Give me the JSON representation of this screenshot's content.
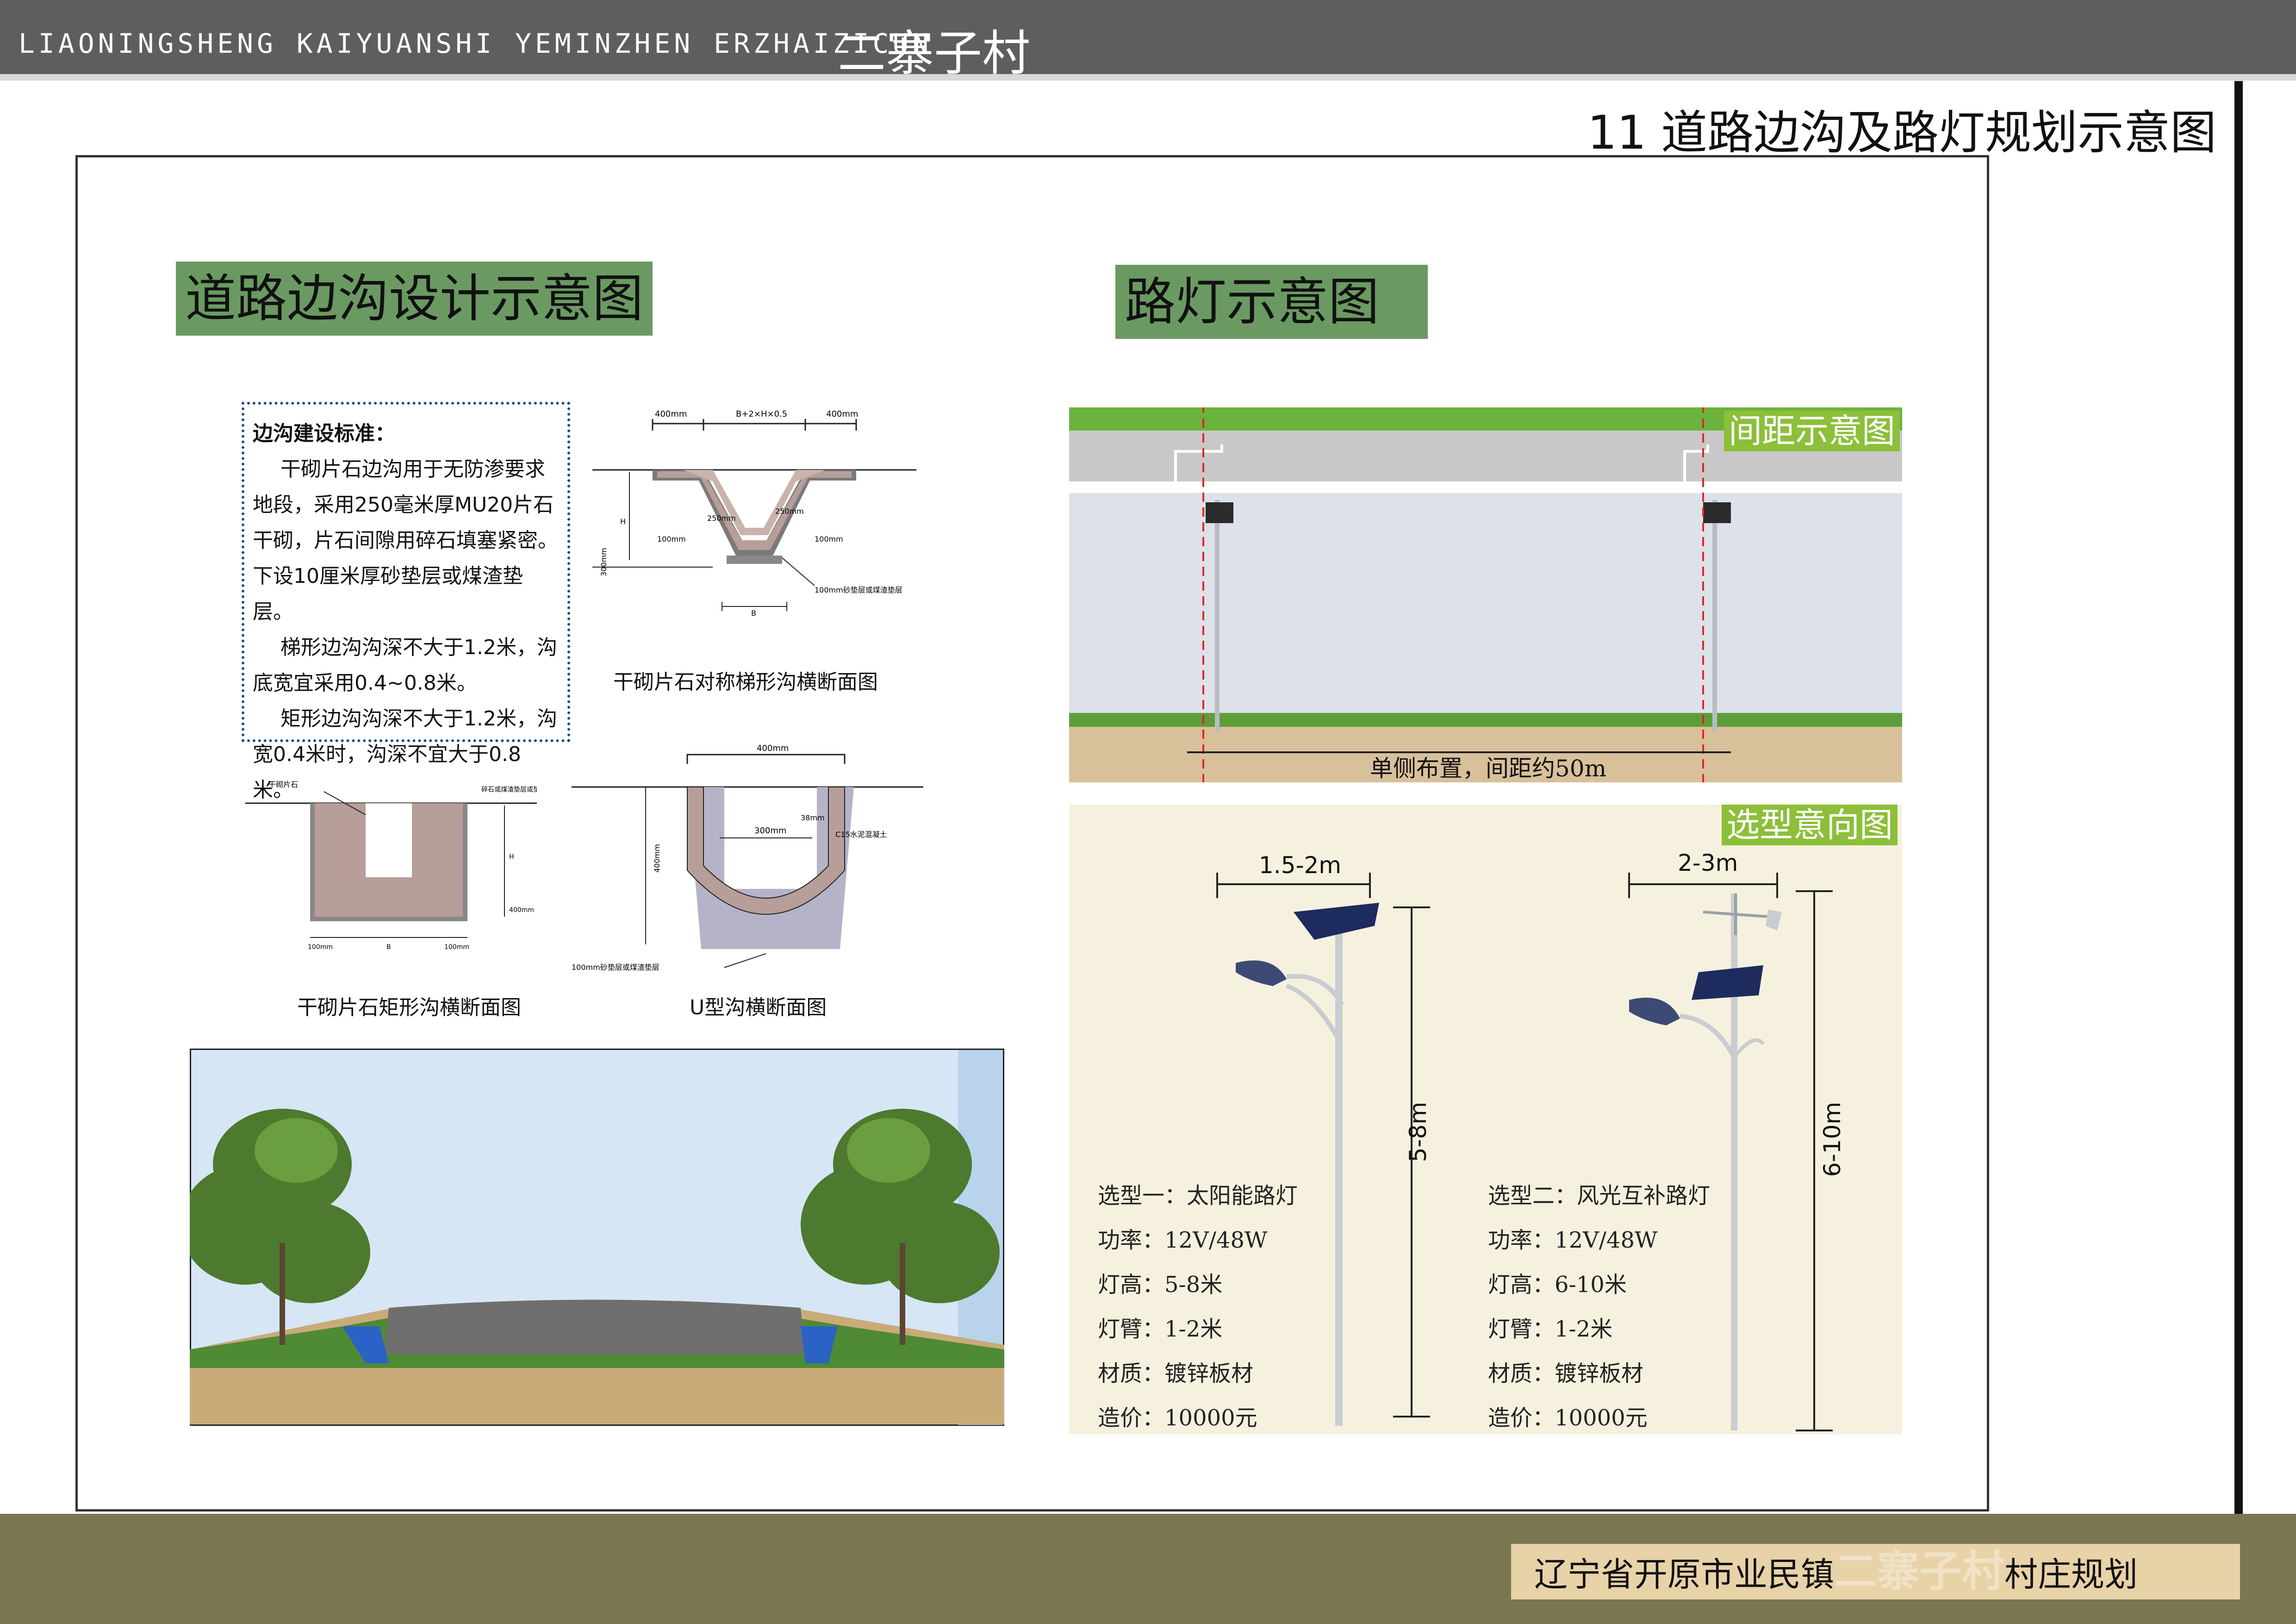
{
  "header": {
    "pinyin": "LIAONINGSHENG KAIYUANSHI YEMINZHEN ERZHAIZICUN",
    "village": "二寨子村",
    "page_title": "11 道路边沟及路灯规划示意图"
  },
  "ditch_section": {
    "title": "道路边沟设计示意图",
    "standards_heading": "边沟建设标准：",
    "standards_lines": [
      "干砌片石边沟用于无防渗要求",
      "地段，采用250毫米厚MU20片石",
      "干砌，片石间隙用碎石填塞紧密。",
      "下设10厘米厚砂垫层或煤渣垫层。",
      "梯形边沟沟深不大于1.2米，沟",
      "底宽宜采用0.4~0.8米。",
      "矩形边沟沟深不大于1.2米，沟",
      "宽0.4米时，沟深不宜大于0.8米。"
    ],
    "caption_trapezoid": "干砌片石对称梯形沟横断面图",
    "caption_rect": "干砌片石矩形沟横断面图",
    "caption_u": "U型沟横断面图",
    "trap_labels": {
      "top_left": "400mm",
      "top_mid": "B+2×H×0.5",
      "top_right": "400mm",
      "t1": "250mm",
      "t2": "250mm",
      "t3": "100mm",
      "t4": "100mm",
      "pad": "100mm砂垫层或煤渣垫层",
      "h": "H",
      "hside": "300mm",
      "b": "B"
    },
    "rect_labels": {
      "stone": "干砌片石",
      "pad": "碎石或煤渣垫层或垫层",
      "b1": "100mm",
      "b2": "B",
      "b3": "100mm",
      "h": "H",
      "h2": "400mm"
    },
    "u_labels": {
      "top": "400mm",
      "inner": "300mm",
      "t": "38mm",
      "concrete": "C15水泥混凝土",
      "pad": "100mm砂垫层或煤渣垫层",
      "h": "400mm"
    }
  },
  "lamp_section": {
    "title": "路灯示意图",
    "spacing_tag": "间距示意图",
    "spacing_note": "单侧布置，间距约50m",
    "model_tag": "选型意向图",
    "lamp1": {
      "arm": "1.5-2m",
      "height": "5-8m",
      "specs": [
        "选型一：太阳能路灯",
        "功率：12V/48W",
        "灯高：5-8米",
        "灯臂：1-2米",
        "材质：镀锌板材",
        "造价：10000元"
      ]
    },
    "lamp2": {
      "arm": "2-3m",
      "height": "6-10m",
      "specs": [
        "选型二：风光互补路灯",
        "功率：12V/48W",
        "灯高：6-10米",
        "灯臂：1-2米",
        "材质：镀锌板材",
        "造价：10000元"
      ]
    }
  },
  "footer": {
    "prefix": "辽宁省开原市业民镇",
    "village": "二寨子村",
    "suffix": "村庄规划"
  },
  "colors": {
    "title_green": "#6a9a62",
    "tag_green": "#8cbf3a",
    "header_gray": "#5e5e5e",
    "footer_olive": "#7a7650",
    "footer_label": "#e8d2a8"
  }
}
